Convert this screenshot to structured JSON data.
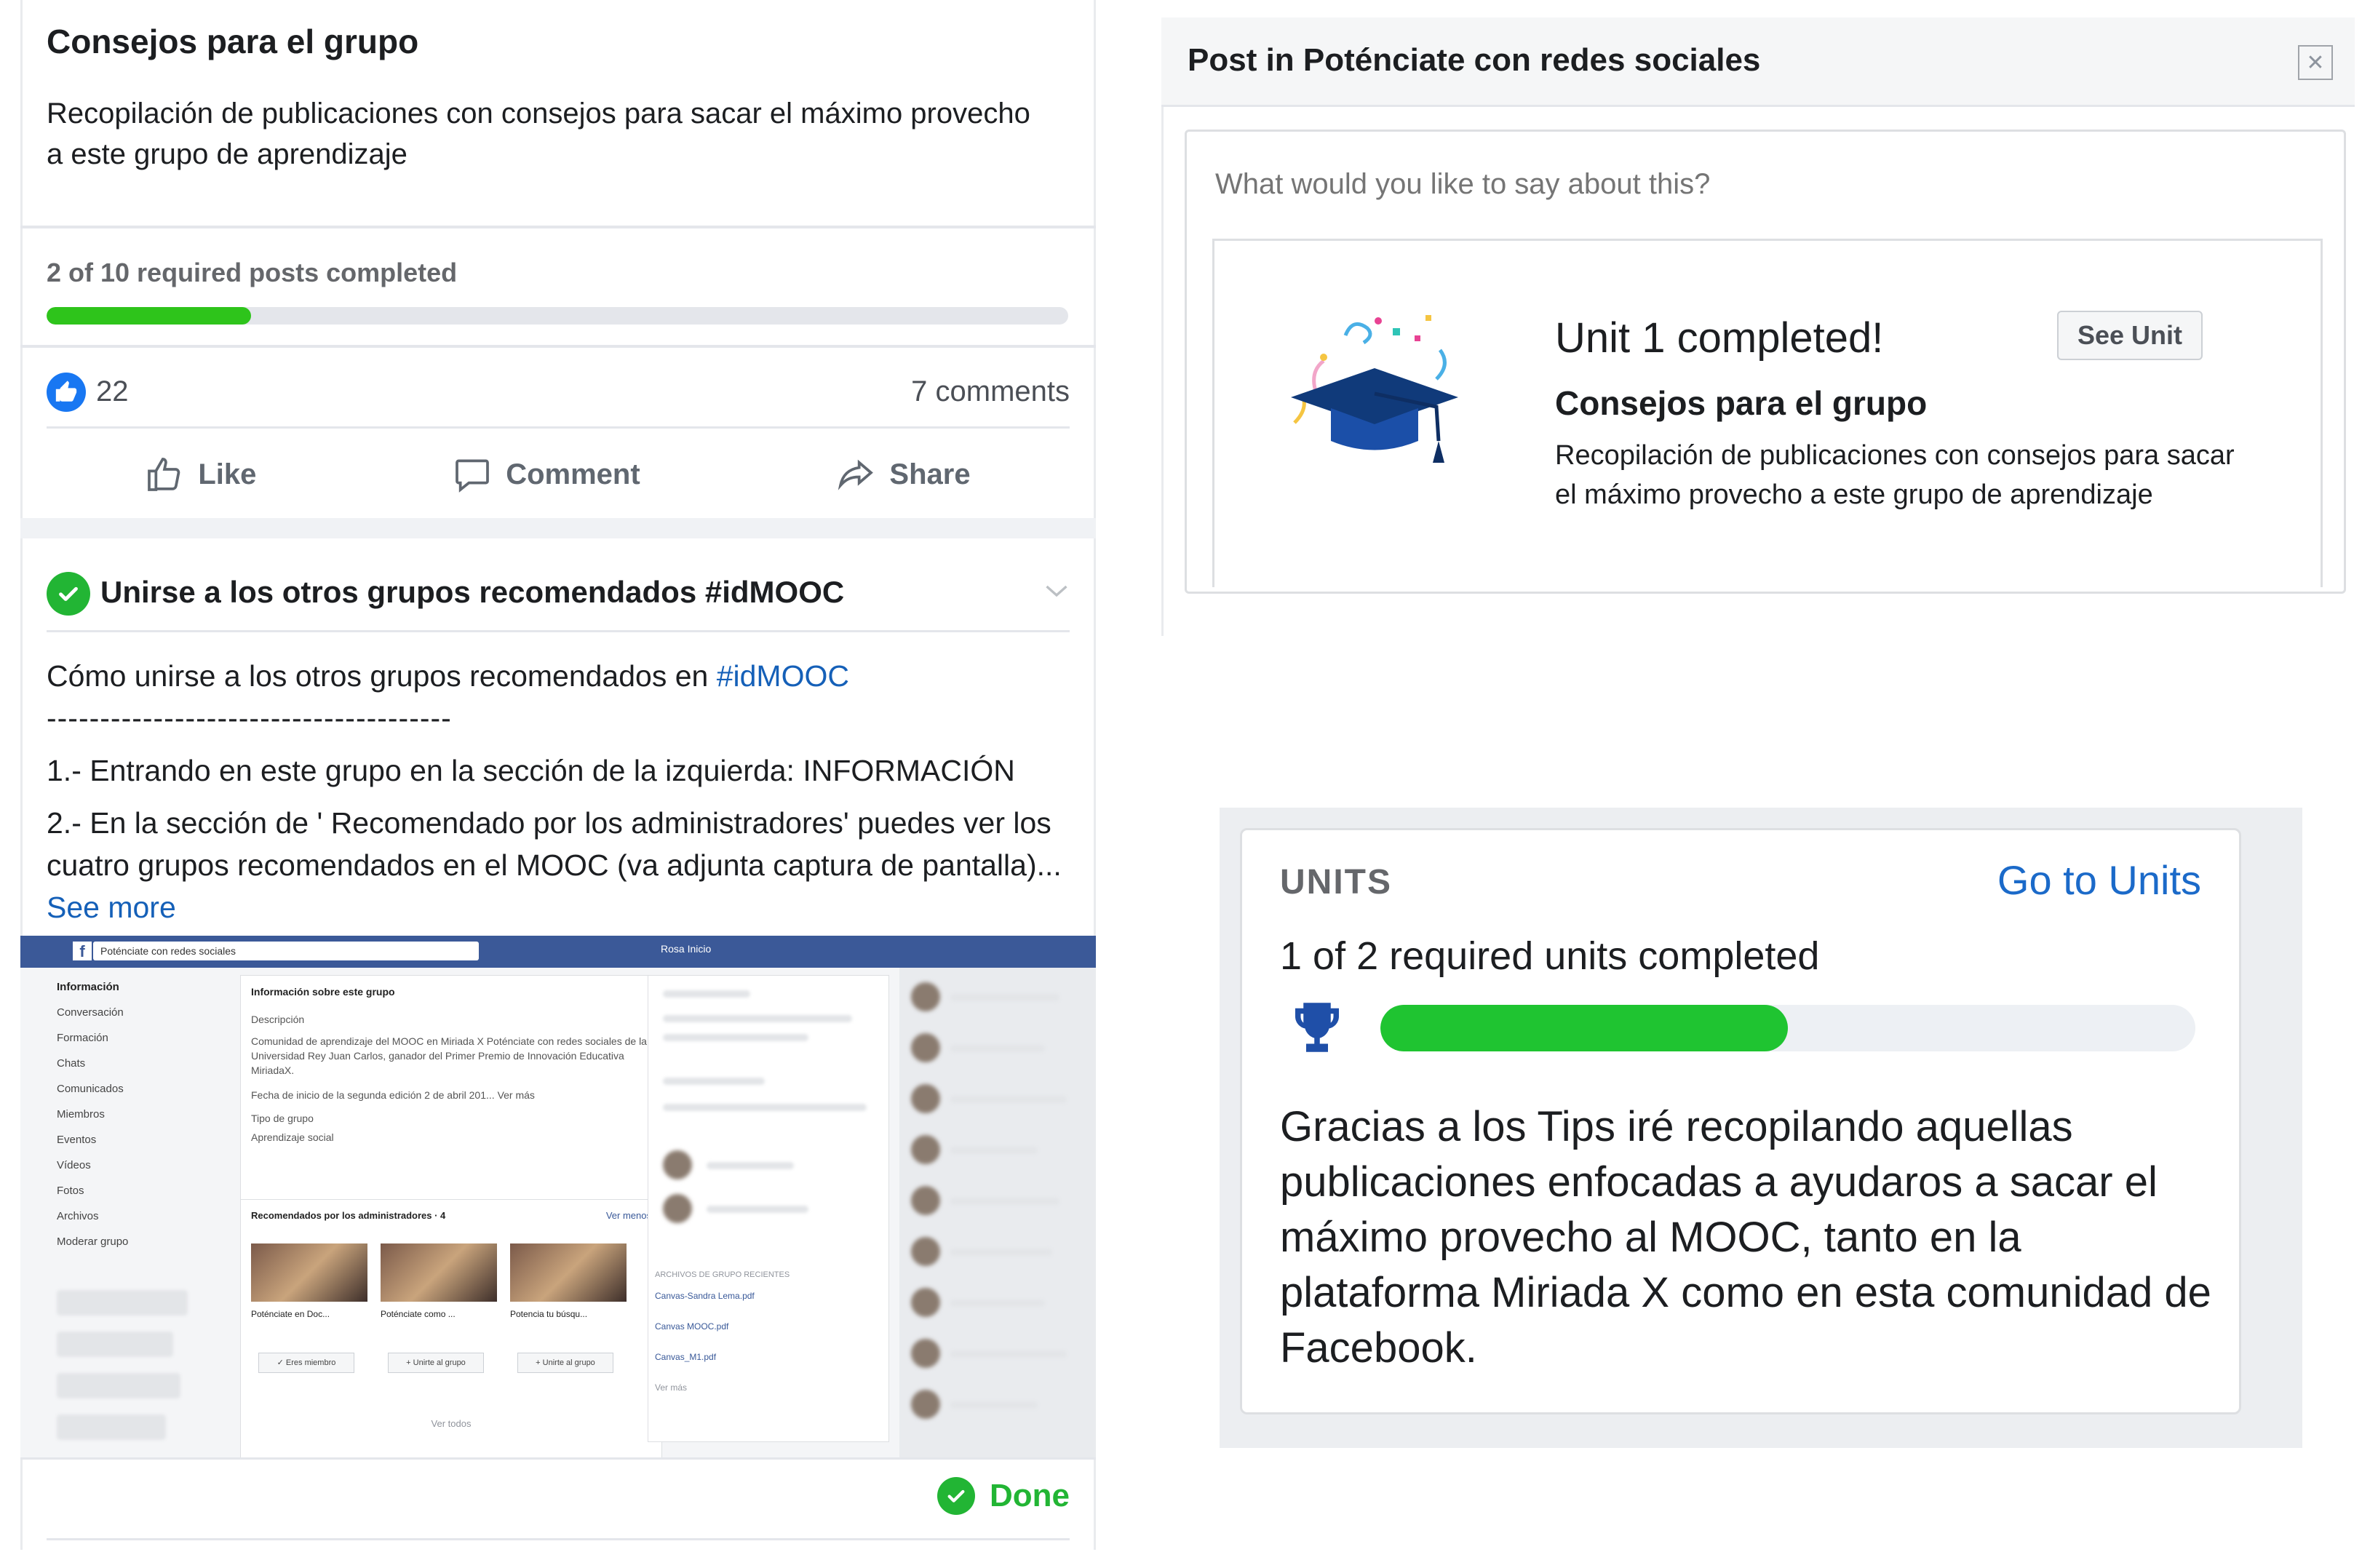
{
  "post": {
    "title": "Consejos para el grupo",
    "description": "Recopilación de publicaciones con consejos para sacar el máximo provecho a este grupo de aprendizaje",
    "progress_label": "2 of 10 required posts completed",
    "progress_completed": 2,
    "progress_required": 10,
    "likes": "22",
    "comments": "7 comments",
    "actions": {
      "like": "Like",
      "comment": "Comment",
      "share": "Share"
    }
  },
  "task": {
    "title": "Unirse a los otros grupos recomendados #idMOOC",
    "intro": "Cómo unirse a los otros grupos recomendados en ",
    "hashtag": "#idMOOC",
    "separator": "--------------------------------------",
    "step1": "1.- Entrando en este grupo en la sección de la izquierda: INFORMACIÓN",
    "step2": "2.- En la sección de ' Recomendado por los administradores' puedes ver los cuatro grupos recomendados en el MOOC (va adjunta captura de pantalla)...",
    "see_more": "See more",
    "done": "Done"
  },
  "embedded": {
    "search": "Poténciate con redes sociales",
    "user": "Rosa   Inicio",
    "sidebar": [
      "Información",
      "Conversación",
      "Formación",
      "Chats",
      "Comunicados",
      "Miembros",
      "Eventos",
      "Vídeos",
      "Fotos",
      "Archivos",
      "Moderar grupo"
    ],
    "info_title": "Información sobre este grupo",
    "info_desc_label": "Descripción",
    "info_desc": "Comunidad de aprendizaje del MOOC en Miriada X Poténciate con redes sociales de la Universidad Rey Juan Carlos, ganador del Primer Premio de Innovación Educativa MiriadaX.",
    "info_date": "Fecha de inicio de la segunda edición 2 de abril 201... Ver más",
    "info_type_label": "Tipo de grupo",
    "info_type": "Aprendizaje social",
    "rec_title": "Recomendados por los administradores · 4",
    "rec_more": "Ver menos",
    "tiles": [
      {
        "name": "Poténciate en Doc...",
        "button": "✓ Eres miembro"
      },
      {
        "name": "Poténciate como ...",
        "button": "+ Unirte al grupo"
      },
      {
        "name": "Potencia tu búsqu...",
        "button": "+ Unirte al grupo"
      }
    ],
    "see_all": "Ver todos",
    "files_title": "ARCHIVOS DE GRUPO RECIENTES",
    "files": [
      "Canvas-Sandra Lema.pdf",
      "Canvas MOOC.pdf",
      "Canvas_M1.pdf"
    ],
    "files_more": "Ver más"
  },
  "dialog": {
    "title": "Post in Poténciate con redes sociales",
    "placeholder": "What would you like to say about this?",
    "unit_completed": "Unit 1 completed!",
    "see_unit": "See Unit",
    "attach_title": "Consejos para el grupo",
    "attach_desc": "Recopilación de publicaciones con consejos para sacar el máximo provecho a este grupo de aprendizaje"
  },
  "units": {
    "label": "UNITS",
    "go_to": "Go to Units",
    "progress_label": "1 of 2 required units completed",
    "progress_completed": 1,
    "progress_required": 2,
    "text": "Gracias a los Tips iré recopilando aquellas publicaciones enfocadas a ayudaros a sacar el máximo provecho al MOOC, tanto en la plataforma Miriada X como en esta comunidad de Facebook."
  },
  "colors": {
    "progress_green": "#2ec41b",
    "done_green": "#22b534",
    "facebook_blue": "#1877f2",
    "link_blue": "#1560b8"
  },
  "icons": [
    "thumbs-up-icon",
    "like-outline-icon",
    "comment-icon",
    "share-icon",
    "check-circle-icon",
    "chevron-down-icon",
    "close-icon",
    "graduation-cap-icon",
    "trophy-icon"
  ]
}
